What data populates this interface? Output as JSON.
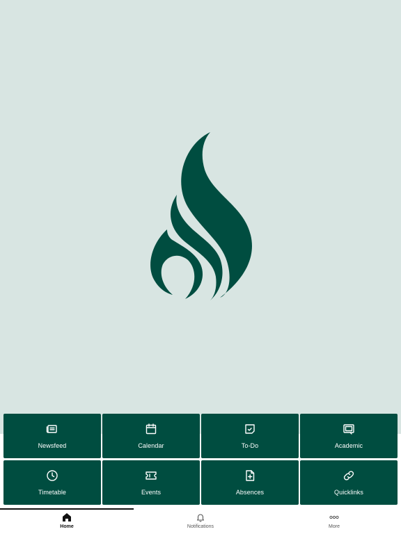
{
  "colors": {
    "hero_background": "#d8e5e2",
    "brand_green": "#004d40",
    "tab_active": "#111111",
    "tab_inactive": "#555555"
  },
  "logo": {
    "icon": "flame-logo"
  },
  "tiles": [
    {
      "label": "Newsfeed",
      "icon": "newspaper-icon"
    },
    {
      "label": "Calendar",
      "icon": "calendar-icon"
    },
    {
      "label": "To-Do",
      "icon": "todo-icon"
    },
    {
      "label": "Academic",
      "icon": "academic-icon"
    },
    {
      "label": "Timetable",
      "icon": "clock-icon"
    },
    {
      "label": "Events",
      "icon": "ticket-icon"
    },
    {
      "label": "Absences",
      "icon": "document-plus-icon"
    },
    {
      "label": "Quicklinks",
      "icon": "link-icon"
    }
  ],
  "tabbar": {
    "active": "Home",
    "items": [
      {
        "label": "Home",
        "icon": "home-icon"
      },
      {
        "label": "Notifications",
        "icon": "bell-icon"
      },
      {
        "label": "More",
        "icon": "more-dots-icon"
      }
    ]
  }
}
